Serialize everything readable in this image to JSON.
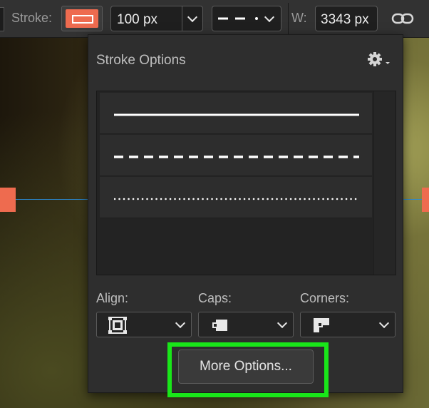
{
  "toolbar": {
    "stroke_label": "Stroke:",
    "stroke_color": "#ee6b4f",
    "stroke_width_value": "100 px",
    "width_label": "W:",
    "width_value": "3343 px",
    "link_icon": "link-icon"
  },
  "panel": {
    "title": "Stroke Options",
    "settings_icon": "gear-icon",
    "line_styles": [
      "solid",
      "dashed",
      "dotted"
    ],
    "align_label": "Align:",
    "caps_label": "Caps:",
    "corners_label": "Corners:",
    "more_options_label": "More Options..."
  },
  "colors": {
    "accent": "#ee6b4f",
    "guide": "#2a8bd6",
    "highlight": "#19e619"
  }
}
